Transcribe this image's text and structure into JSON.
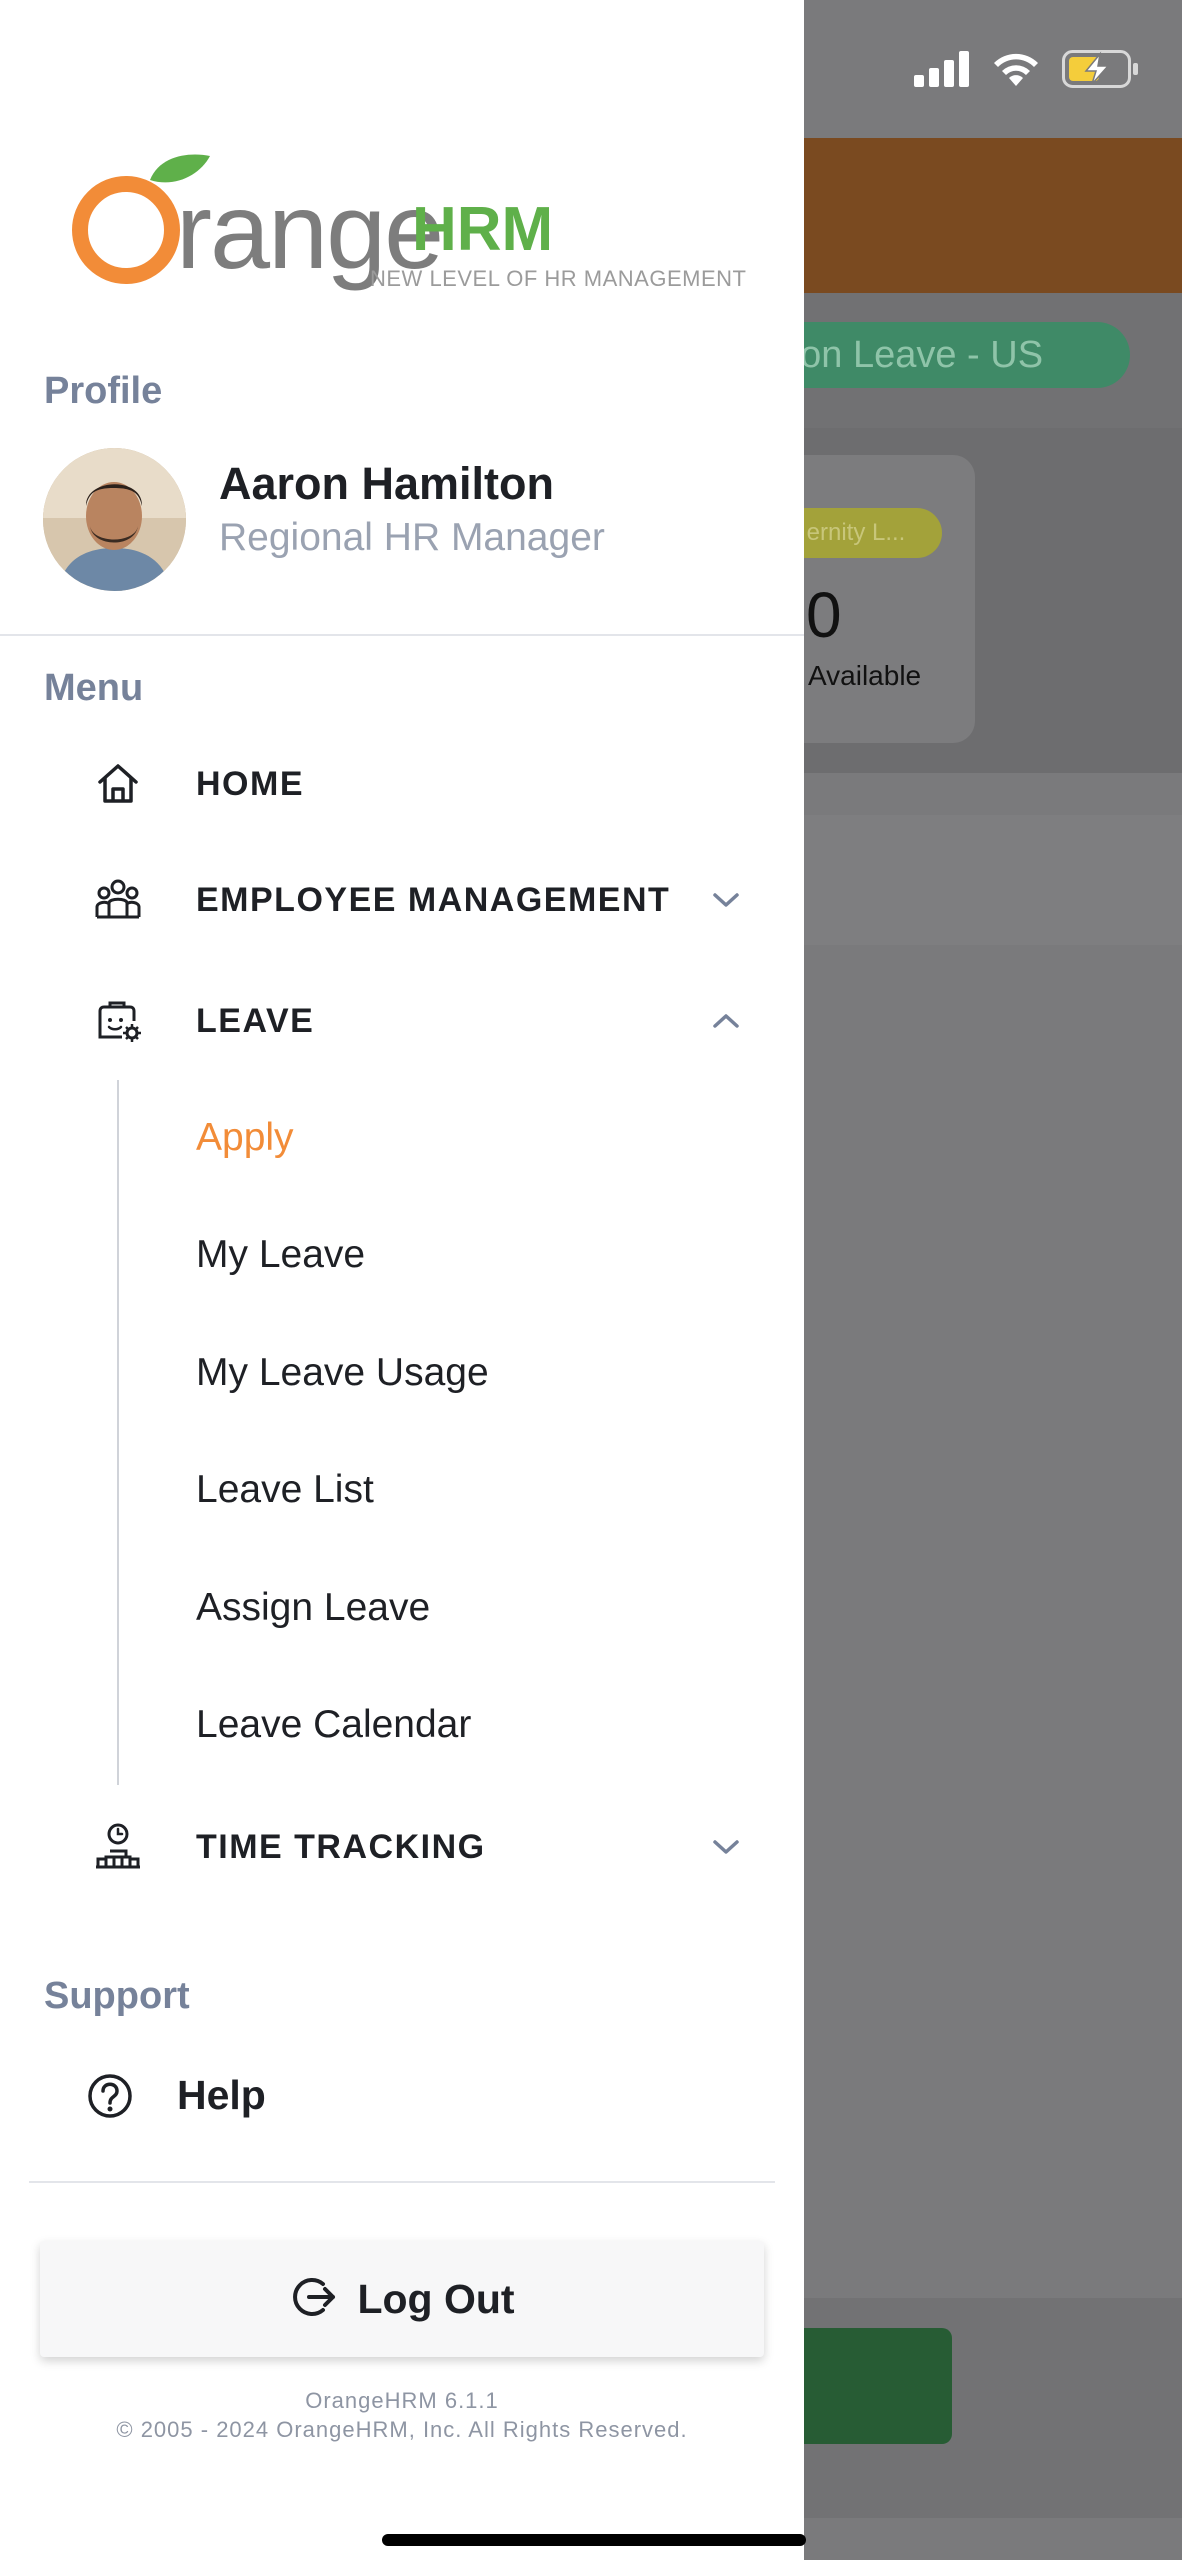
{
  "status_bar": {
    "icons": [
      "cellular-signal-icon",
      "wifi-icon",
      "battery-charging-icon"
    ]
  },
  "background": {
    "leave_type_chip": "ation Leave - US",
    "card_tag": "ernity L...",
    "card_count": "0",
    "card_caption": "Available"
  },
  "drawer": {
    "logo": {
      "brand_orange": "Orange",
      "brand_green": "HRM",
      "tagline": "NEW LEVEL OF HR MANAGEMENT",
      "colors": {
        "orange": "#f28c38",
        "green": "#5fb04a"
      }
    },
    "profile": {
      "section_label": "Profile",
      "name": "Aaron Hamilton",
      "role": "Regional HR Manager"
    },
    "menu": {
      "section_label": "Menu",
      "items": [
        {
          "label": "HOME",
          "icon": "home-icon"
        },
        {
          "label": "EMPLOYEE MANAGEMENT",
          "icon": "people-icon",
          "chevron": "chevron-down-icon"
        },
        {
          "label": "LEAVE",
          "icon": "leave-icon",
          "chevron": "chevron-up-icon",
          "expanded": true
        },
        {
          "label": "TIME TRACKING",
          "icon": "time-tracking-icon",
          "chevron": "chevron-down-icon"
        }
      ],
      "leave_subitems": [
        {
          "label": "Apply",
          "active": true
        },
        {
          "label": "My Leave"
        },
        {
          "label": "My Leave Usage"
        },
        {
          "label": "Leave List"
        },
        {
          "label": "Assign Leave"
        },
        {
          "label": "Leave Calendar"
        }
      ]
    },
    "support": {
      "section_label": "Support",
      "help_label": "Help",
      "help_icon": "question-circle-icon"
    },
    "logout": {
      "label": "Log Out",
      "icon": "logout-icon"
    },
    "footer": {
      "version": "OrangeHRM 6.1.1",
      "copyright": "© 2005 - 2024 OrangeHRM, Inc. All Rights Reserved."
    },
    "accent_color": "#f28c38"
  }
}
